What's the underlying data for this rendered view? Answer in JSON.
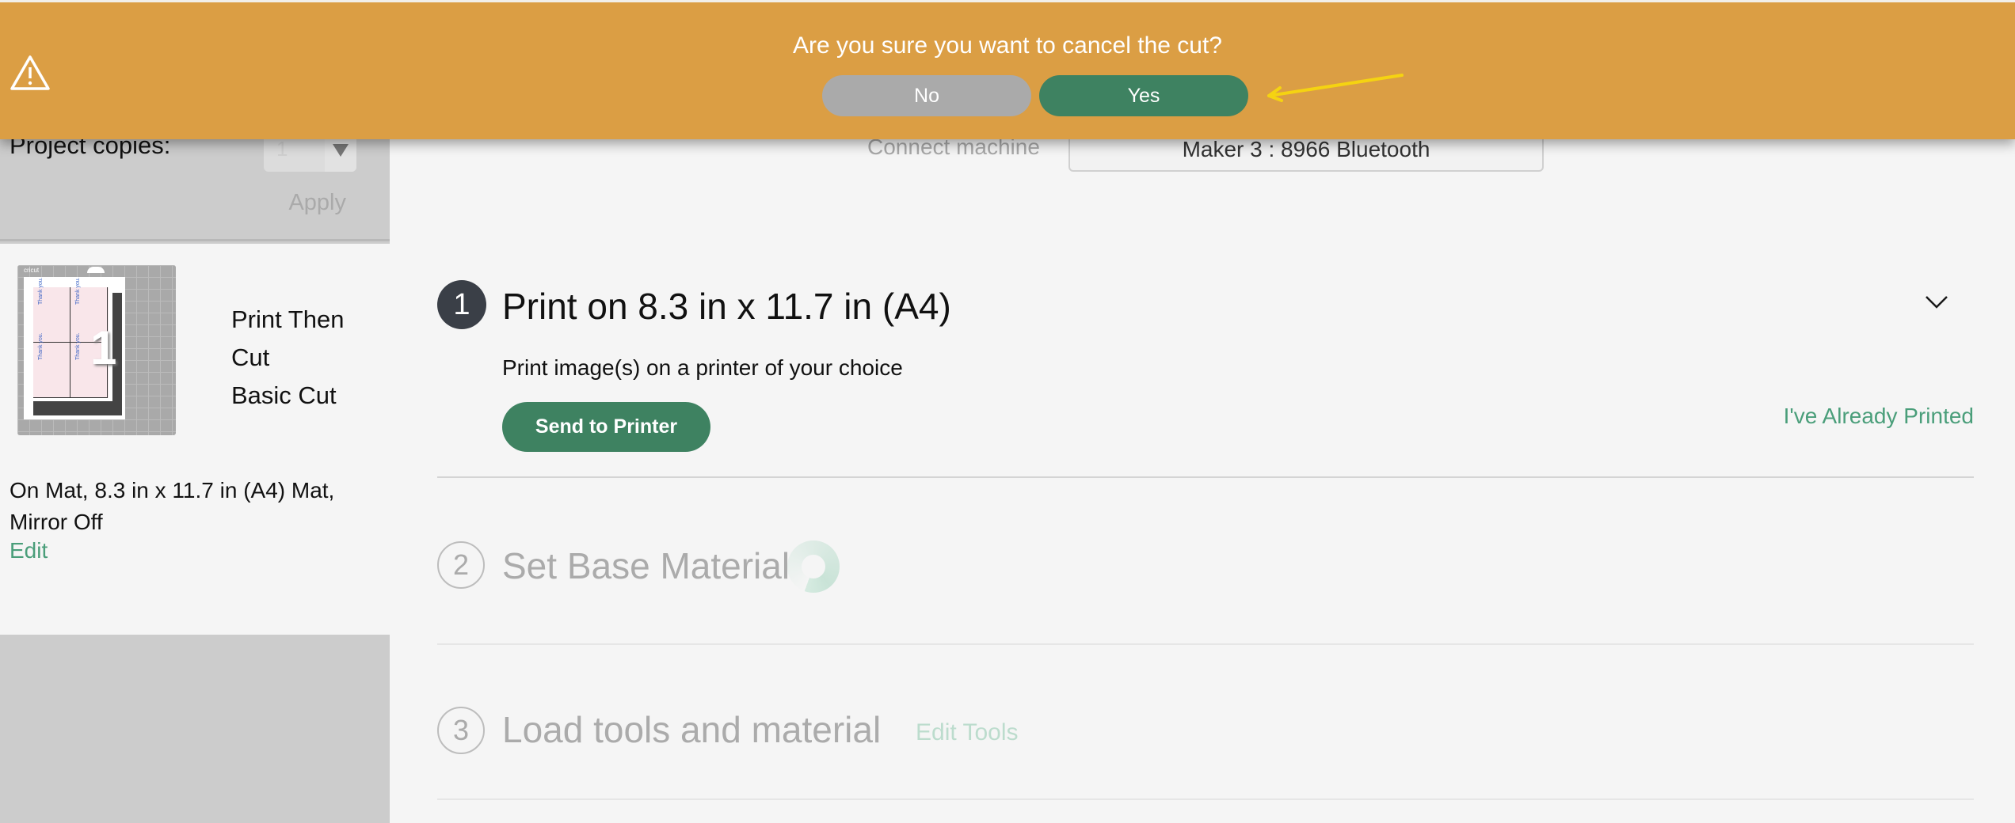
{
  "banner": {
    "message": "Are you sure you want to cancel the cut?",
    "no_label": "No",
    "yes_label": "Yes",
    "icon": "warning-triangle-icon",
    "color": "#DB9E44",
    "annotation": "yellow-arrow-pointing-to-yes"
  },
  "sidebar": {
    "copies_label": "Project copies:",
    "copies_value": "1",
    "apply_label": "Apply",
    "mat": {
      "thumbnail_brand": "cricut",
      "thumbnail_number": "1",
      "thumbnail_text": "Thank you.",
      "name_lines": [
        "Print Then",
        "Cut",
        "Basic Cut"
      ],
      "info": "On Mat, 8.3 in x 11.7 in (A4) Mat, Mirror Off",
      "edit_label": "Edit"
    }
  },
  "machine": {
    "label": "Connect machine",
    "selected": "Maker 3 : 8966 Bluetooth"
  },
  "steps": [
    {
      "number": "1",
      "title": "Print on 8.3 in x 11.7 in (A4)",
      "description": "Print image(s) on a printer of your choice",
      "primary_button": "Send to Printer",
      "secondary_link": "I've Already Printed",
      "state": "active"
    },
    {
      "number": "2",
      "title": "Set Base Material",
      "state": "loading"
    },
    {
      "number": "3",
      "title": "Load tools and material",
      "link": "Edit Tools",
      "state": "inactive"
    }
  ],
  "colors": {
    "accent_green": "#3E8261",
    "link_green": "#4A9E7A",
    "banner_orange": "#DB9E44",
    "sidebar_gray": "#CCCCCC"
  }
}
